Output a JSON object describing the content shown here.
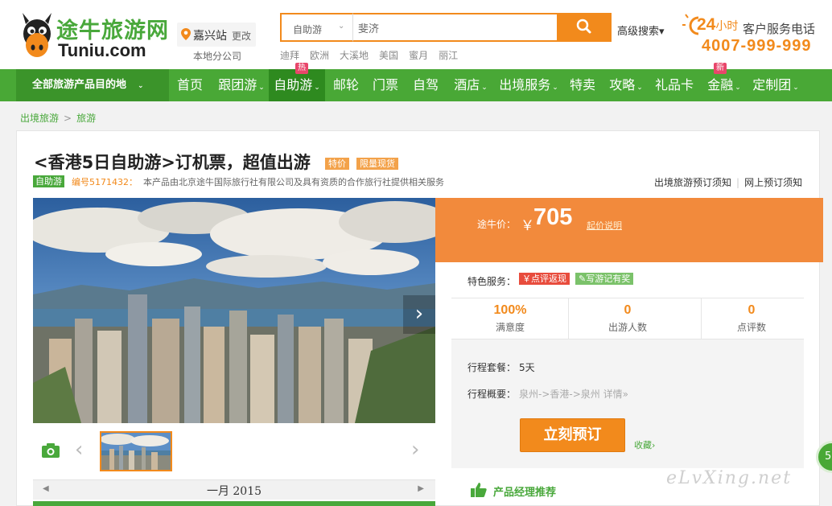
{
  "header": {
    "logo_cn": "途牛旅游网",
    "logo_en": "Tuniu.com",
    "city": "嘉兴站",
    "city_change": "更改",
    "city_sub": "本地分公司",
    "search_type": "自助游",
    "search_value": "斐济",
    "advanced_search": "高级搜索▾",
    "hot_words": [
      "迪拜",
      "欧洲",
      "大溪地",
      "美国",
      "蜜月",
      "丽江"
    ],
    "service_hours": "24",
    "service_hours_unit": "小时",
    "service_text": "客户服务电话",
    "phone": "4007-999-999"
  },
  "nav": {
    "all": "全部旅游产品目的地",
    "items": [
      "首页",
      "跟团游",
      "自助游",
      "邮轮",
      "门票",
      "自驾",
      "酒店",
      "出境服务",
      "特卖",
      "攻略",
      "礼品卡",
      "金融",
      "定制团"
    ],
    "badge_hot": "热",
    "badge_new": "新"
  },
  "breadcrumb": [
    "出境旅游",
    "旅游"
  ],
  "product": {
    "title": "<香港5日自助游>订机票，超值出游",
    "tag_special": "特价",
    "tag_limited": "限量现货",
    "type_tag": "自助游",
    "code": "编号5171432：",
    "desc": "本产品由北京途牛国际旅行社有限公司及具有资质的合作旅行社提供相关服务",
    "link_notice": "出境旅游预订须知",
    "link_online": "网上预订须知",
    "calendar_month": "一月 2015",
    "price_label": "途牛价：",
    "currency": "￥",
    "price": "705",
    "price_note": "起价说明",
    "feature_label": "特色服务：",
    "feature1": "￥点评返现",
    "feature2": "✎写游记有奖",
    "stats": [
      {
        "value": "100%",
        "label": "满意度"
      },
      {
        "value": "0",
        "label": "出游人数"
      },
      {
        "value": "0",
        "label": "点评数"
      }
    ],
    "package_label": "行程套餐：",
    "package_value": "5天",
    "route_label": "行程概要：",
    "route_value": "泉州->香港->泉州",
    "route_detail": "详情»",
    "book_button": "立刻预订",
    "favorite": "收藏›",
    "recommend": "产品经理推荐"
  },
  "watermark": "eLvXing.net",
  "float_ball": "5",
  "colors": {
    "brand_green": "#49a836",
    "brand_orange": "#f28a1c"
  }
}
